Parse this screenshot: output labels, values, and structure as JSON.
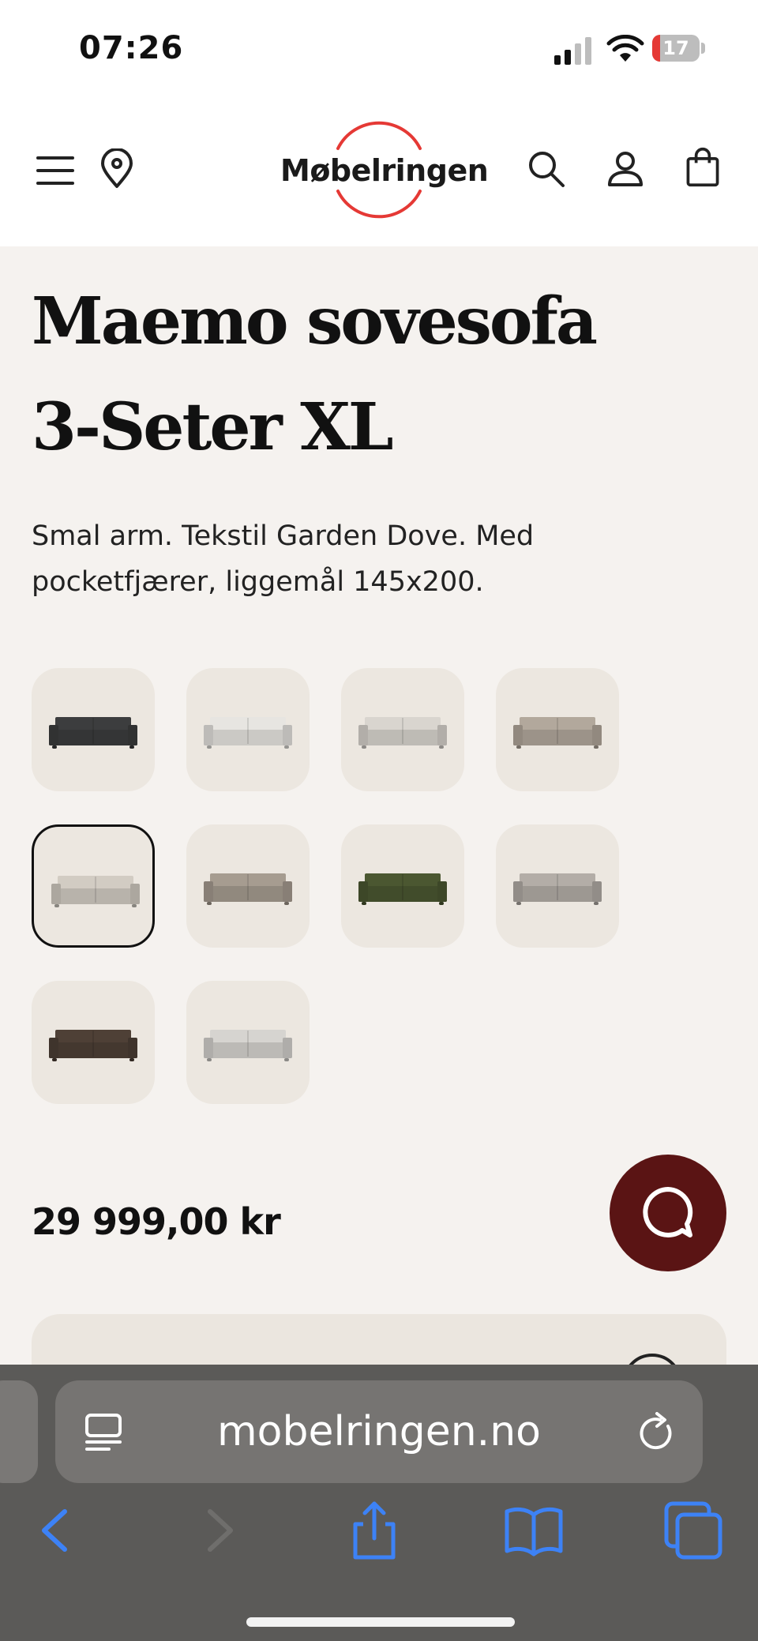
{
  "status_bar": {
    "time": "07:26",
    "battery_level": "17",
    "battery_fraction": 0.17,
    "icons": [
      "signal-icon",
      "wifi-icon",
      "battery-icon"
    ]
  },
  "header": {
    "logo_text": "Møbelringen",
    "logo_ring_color": "#e53935",
    "icons": [
      "menu-icon",
      "location-icon",
      "search-icon",
      "account-icon",
      "cart-icon"
    ]
  },
  "product": {
    "title": "Maemo sovesofa 3-Seter XL",
    "description": "Smal arm. Tekstil Garden Dove. Med pocketfjærer, liggemål 145x200.",
    "price": "29 999,00 kr",
    "swatches": [
      {
        "color": "#3c3d3e",
        "selected": false
      },
      {
        "color": "#e7e5e1",
        "selected": false
      },
      {
        "color": "#d9d5cf",
        "selected": false
      },
      {
        "color": "#b2a89c",
        "selected": false
      },
      {
        "color": "#d2ccc3",
        "selected": true
      },
      {
        "color": "#a69c90",
        "selected": false
      },
      {
        "color": "#4b5731",
        "selected": false
      },
      {
        "color": "#b3ada7",
        "selected": false
      },
      {
        "color": "#4e4036",
        "selected": false
      },
      {
        "color": "#d6d4d0",
        "selected": false
      }
    ]
  },
  "chat": {
    "icon": "chat-icon",
    "color": "#5a1414"
  },
  "browser": {
    "url": "mobelringen.no",
    "accent_color": "#3d82f6",
    "icons": [
      "reader-icon",
      "reload-icon",
      "back-icon",
      "forward-icon",
      "share-icon",
      "bookmarks-icon",
      "tabs-icon"
    ]
  }
}
